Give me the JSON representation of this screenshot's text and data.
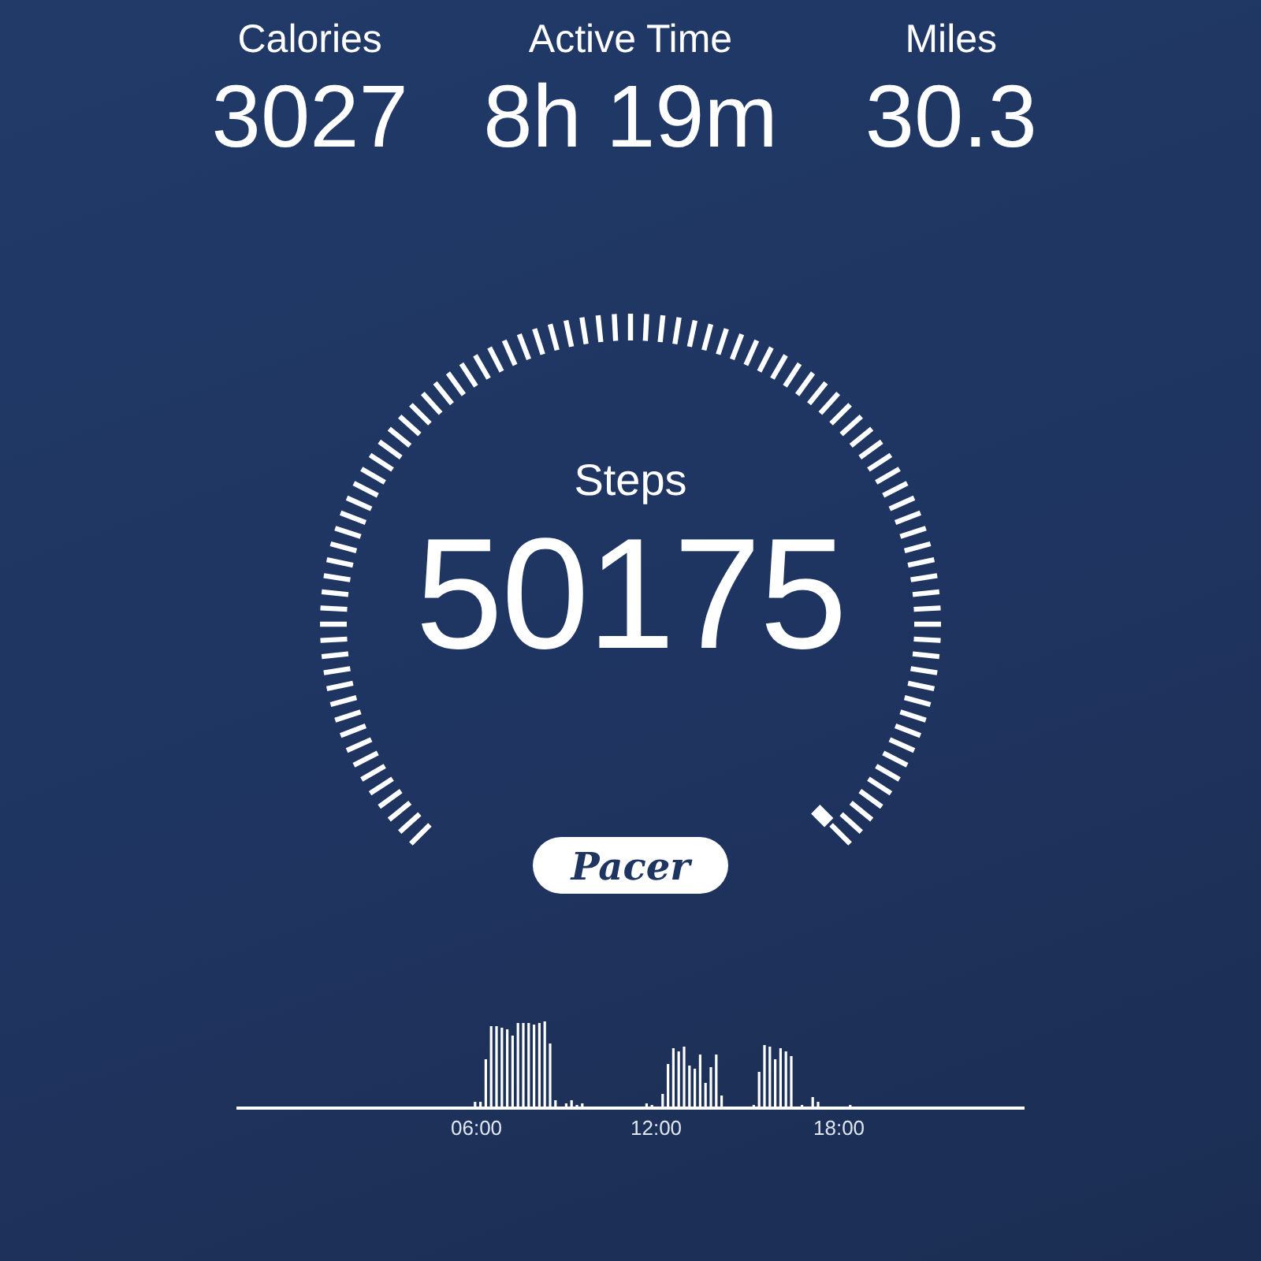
{
  "stats": [
    {
      "label": "Calories",
      "value": "3027"
    },
    {
      "label": "Active Time",
      "value": "8h 19m"
    },
    {
      "label": "Miles",
      "value": "30.3"
    }
  ],
  "gauge": {
    "label": "Steps",
    "value": "50175"
  },
  "logo": "Pacer",
  "activity": {
    "kind": "picture",
    "axis_labels": [
      "06:00",
      "12:00",
      "18:00"
    ]
  }
}
